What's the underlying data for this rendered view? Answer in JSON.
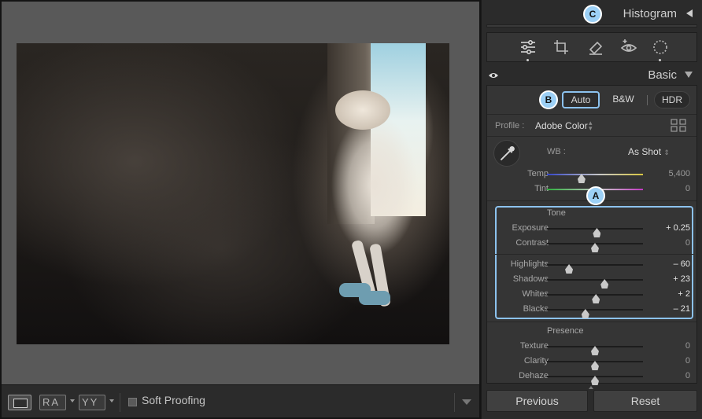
{
  "toolbar": {
    "ra_label": "RA",
    "yy_label": "YY",
    "soft_proofing_label": "Soft Proofing"
  },
  "histogram": {
    "title": "Histogram"
  },
  "basic": {
    "title": "Basic",
    "treatment_buttons": {
      "auto": "Auto",
      "bw": "B&W",
      "hdr": "HDR"
    },
    "profile": {
      "label": "Profile :",
      "value": "Adobe Color"
    },
    "wb": {
      "label": "WB :",
      "value": "As Shot"
    },
    "temp": {
      "label": "Temp",
      "value": "5,400",
      "fraction": 0.36
    },
    "tint": {
      "label": "Tint",
      "value": "0",
      "fraction": 0.5
    },
    "tone": {
      "title": "Tone",
      "exposure": {
        "label": "Exposure",
        "value": "+ 0.25",
        "fraction": 0.52
      },
      "contrast": {
        "label": "Contrast",
        "value": "0",
        "fraction": 0.5
      },
      "highlights": {
        "label": "Highlights",
        "value": "– 60",
        "fraction": 0.23
      },
      "shadows": {
        "label": "Shadows",
        "value": "+ 23",
        "fraction": 0.6
      },
      "whites": {
        "label": "Whites",
        "value": "+ 2",
        "fraction": 0.51
      },
      "blacks": {
        "label": "Blacks",
        "value": "– 21",
        "fraction": 0.4
      }
    },
    "presence": {
      "title": "Presence",
      "texture": {
        "label": "Texture",
        "value": "0",
        "fraction": 0.5
      },
      "clarity": {
        "label": "Clarity",
        "value": "0",
        "fraction": 0.5
      },
      "dehaze": {
        "label": "Dehaze",
        "value": "0",
        "fraction": 0.5
      }
    }
  },
  "callouts": {
    "a": "A",
    "b": "B",
    "c": "C"
  },
  "buttons": {
    "previous": "Previous",
    "reset": "Reset"
  },
  "icons": [
    "edit-sliders-icon",
    "crop-icon",
    "eraser-icon",
    "red-eye-icon",
    "mask-icon",
    "eye-icon",
    "profile-grid-icon",
    "eyedropper-icon"
  ],
  "colors": {
    "accent_outline": "#8cc2ee",
    "callout_fill": "#9cd0f6"
  }
}
